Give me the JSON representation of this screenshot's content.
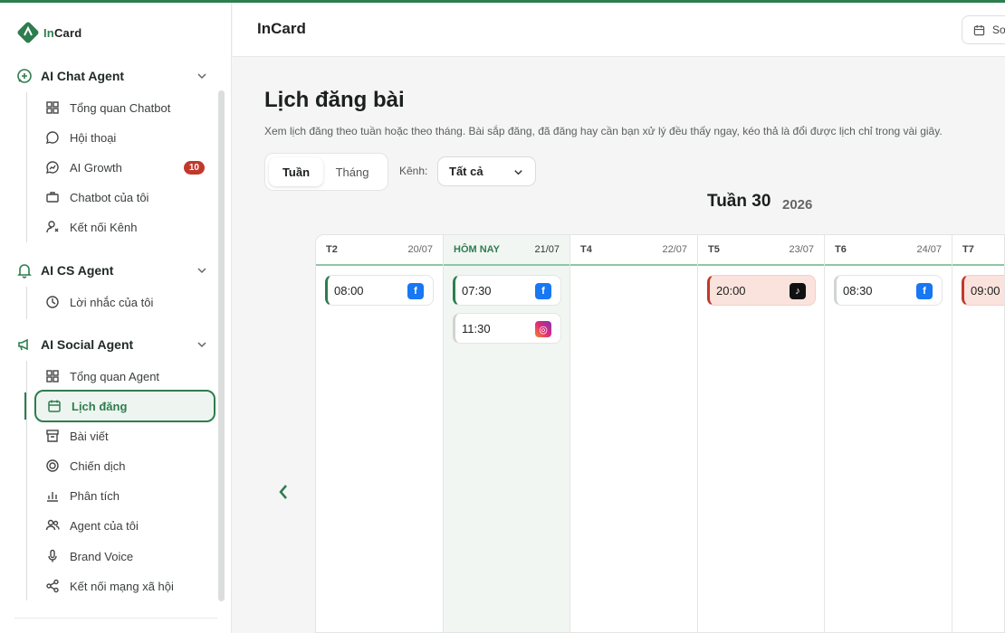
{
  "app": {
    "name": "InCard",
    "logo_prefix": "In",
    "logo_suffix": "Card"
  },
  "sidebar": {
    "groups": [
      {
        "title": "AI Chat Agent",
        "icon": "chat-plus-icon",
        "items": [
          {
            "label": "Tổng quan Chatbot",
            "icon": "grid-icon"
          },
          {
            "label": "Hội thoại",
            "icon": "message-icon"
          },
          {
            "label": "AI Growth",
            "icon": "trend-message-icon",
            "badge": "10"
          },
          {
            "label": "Chatbot của tôi",
            "icon": "briefcase-icon"
          },
          {
            "label": "Kết nối Kênh",
            "icon": "user-link-icon"
          }
        ]
      },
      {
        "title": "AI CS Agent",
        "icon": "bell-icon",
        "items": [
          {
            "label": "Lời nhắc của tôi",
            "icon": "clock-icon"
          }
        ]
      },
      {
        "title": "AI Social Agent",
        "icon": "megaphone-icon",
        "items": [
          {
            "label": "Tổng quan Agent",
            "icon": "grid-icon"
          },
          {
            "label": "Lịch đăng",
            "icon": "calendar-icon",
            "active": true
          },
          {
            "label": "Bài viết",
            "icon": "archive-icon"
          },
          {
            "label": "Chiến dịch",
            "icon": "target-icon"
          },
          {
            "label": "Phân tích",
            "icon": "bar-chart-icon"
          },
          {
            "label": "Agent của tôi",
            "icon": "users-icon"
          },
          {
            "label": "Brand Voice",
            "icon": "mic-icon"
          },
          {
            "label": "Kết nối mạng xã hội",
            "icon": "share-icon"
          }
        ]
      }
    ]
  },
  "header": {
    "title": "InCard",
    "button_label": "So"
  },
  "page": {
    "title": "Lịch đăng bài",
    "description": "Xem lịch đăng theo tuần hoặc theo tháng. Bài sắp đăng, đã đăng hay cần bạn xử lý đều thấy ngay, kéo thả là đổi được lịch chỉ trong vài giây.",
    "view_tabs": [
      {
        "label": "Tuần",
        "selected": true
      },
      {
        "label": "Tháng",
        "selected": false
      }
    ],
    "channel_label": "Kênh:",
    "channel_value": "Tất cả",
    "week_label": "Tuần 30",
    "year": "2026"
  },
  "calendar": {
    "days": [
      {
        "name": "T2",
        "date": "20/07",
        "today": false,
        "posts": [
          {
            "time": "08:00",
            "channel": "facebook"
          }
        ]
      },
      {
        "name": "HÔM NAY",
        "date": "21/07",
        "today": true,
        "posts": [
          {
            "time": "07:30",
            "channel": "facebook"
          },
          {
            "time": "11:30",
            "channel": "instagram"
          }
        ]
      },
      {
        "name": "T4",
        "date": "22/07",
        "today": false,
        "posts": []
      },
      {
        "name": "T5",
        "date": "23/07",
        "today": false,
        "posts": [
          {
            "time": "20:00",
            "channel": "tiktok"
          }
        ]
      },
      {
        "name": "T6",
        "date": "24/07",
        "today": false,
        "posts": [
          {
            "time": "08:30",
            "channel": "facebook"
          }
        ]
      },
      {
        "name": "T7",
        "date": "",
        "today": false,
        "posts": [
          {
            "time": "09:00",
            "channel": ""
          }
        ]
      }
    ]
  },
  "colors": {
    "brand": "#2e7d4f",
    "badge": "#c0392b",
    "facebook": "#1877f2",
    "tiktok_bg": "#fbe3dd"
  }
}
